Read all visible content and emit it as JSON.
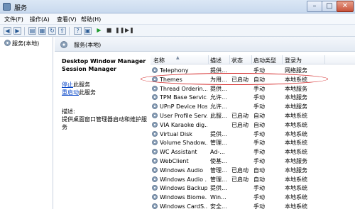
{
  "window": {
    "title": "服务"
  },
  "menu": {
    "items": [
      "文件(F)",
      "操作(A)",
      "查看(V)",
      "帮助(H)"
    ]
  },
  "tree": {
    "root_label": "服务(本地)"
  },
  "pane": {
    "header_label": "服务(本地)"
  },
  "detail": {
    "service_title": "Desktop Window Manager Session Manager",
    "stop_link": "停止",
    "stop_suffix": "此服务",
    "restart_link": "重启动",
    "restart_suffix": "此服务",
    "desc_label": "描述:",
    "desc_text": "提供桌面窗口管理器启动和维护服务"
  },
  "grid": {
    "columns": {
      "name": "名称",
      "desc": "描述",
      "status": "状态",
      "startup": "启动类型",
      "logon": "登录为"
    },
    "rows": [
      {
        "name": "Telephony",
        "desc": "提供...",
        "status": "",
        "startup": "手动",
        "logon": "网络服务"
      },
      {
        "name": "Themes",
        "desc": "为用...",
        "status": "已启动",
        "startup": "自动",
        "logon": "本地系统"
      },
      {
        "name": "Thread Orderin...",
        "desc": "提供...",
        "status": "",
        "startup": "手动",
        "logon": "本地服务"
      },
      {
        "name": "TPM Base Servic...",
        "desc": "允许...",
        "status": "",
        "startup": "手动",
        "logon": "本地服务"
      },
      {
        "name": "UPnP Device Host",
        "desc": "允许...",
        "status": "",
        "startup": "手动",
        "logon": "本地服务"
      },
      {
        "name": "User Profile Serv...",
        "desc": "此服...",
        "status": "已启动",
        "startup": "自动",
        "logon": "本地系统"
      },
      {
        "name": "VIA Karaoke dig...",
        "desc": "",
        "status": "已启动",
        "startup": "自动",
        "logon": "本地系统"
      },
      {
        "name": "Virtual Disk",
        "desc": "提供...",
        "status": "",
        "startup": "手动",
        "logon": "本地系统"
      },
      {
        "name": "Volume Shadow...",
        "desc": "管理...",
        "status": "",
        "startup": "手动",
        "logon": "本地系统"
      },
      {
        "name": "WC Assistant",
        "desc": "Ad-...",
        "status": "",
        "startup": "手动",
        "logon": "本地系统"
      },
      {
        "name": "WebClient",
        "desc": "使基...",
        "status": "",
        "startup": "手动",
        "logon": "本地服务"
      },
      {
        "name": "Windows Audio",
        "desc": "管理...",
        "status": "已启动",
        "startup": "自动",
        "logon": "本地服务"
      },
      {
        "name": "Windows Audio ...",
        "desc": "管理...",
        "status": "已启动",
        "startup": "自动",
        "logon": "本地系统"
      },
      {
        "name": "Windows Backup",
        "desc": "提供...",
        "status": "",
        "startup": "手动",
        "logon": "本地系统"
      },
      {
        "name": "Windows Biome...",
        "desc": "Win...",
        "status": "",
        "startup": "手动",
        "logon": "本地系统"
      },
      {
        "name": "Windows CardS...",
        "desc": "安全...",
        "status": "",
        "startup": "手动",
        "logon": "本地系统"
      }
    ]
  },
  "accent": {
    "highlight": "#d42a2a",
    "link": "#0645c8"
  }
}
